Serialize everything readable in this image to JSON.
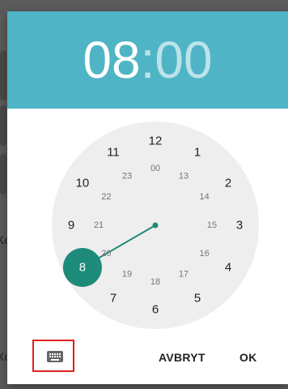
{
  "background": {
    "fragments": [
      "Ko",
      "Kc"
    ]
  },
  "header": {
    "hour": "08",
    "separator": ":",
    "minute": "00",
    "color": "#4fb5c6"
  },
  "clock": {
    "outer_numbers": [
      "12",
      "1",
      "2",
      "3",
      "4",
      "5",
      "6",
      "7",
      "8",
      "9",
      "10",
      "11"
    ],
    "inner_numbers": [
      "00",
      "13",
      "14",
      "15",
      "16",
      "17",
      "18",
      "19",
      "20",
      "21",
      "22",
      "23"
    ],
    "selected_hour": 8,
    "face_color": "#eeeeee",
    "hand_color": "#1e8a7a"
  },
  "footer": {
    "keyboard_icon": "keyboard-icon",
    "cancel_label": "AVBRYT",
    "ok_label": "OK"
  }
}
